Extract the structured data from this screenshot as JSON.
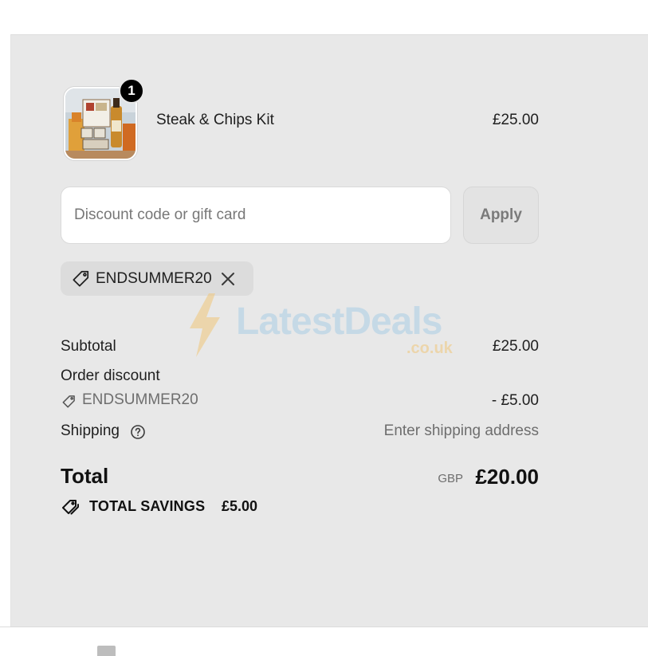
{
  "line_item": {
    "quantity": "1",
    "name": "Steak & Chips Kit",
    "price": "£25.00",
    "image_icon": "product-photo"
  },
  "discount": {
    "placeholder": "Discount code or gift card",
    "value": "",
    "apply_label": "Apply",
    "applied_code": "ENDSUMMER20"
  },
  "watermark": {
    "name": "LatestDeals",
    "suffix": ".co.uk"
  },
  "summary": {
    "subtotal_label": "Subtotal",
    "subtotal_value": "£25.00",
    "order_discount_label": "Order discount",
    "discount_code": "ENDSUMMER20",
    "discount_value": "- £5.00",
    "shipping_label": "Shipping",
    "shipping_value": "Enter shipping address",
    "total_label": "Total",
    "currency": "GBP",
    "total_value": "£20.00",
    "savings_label": "TOTAL SAVINGS",
    "savings_value": "£5.00"
  },
  "colors": {
    "panel_background": "#e8e8e8",
    "badge": "#000000",
    "watermark_blue": "#a9cde6",
    "watermark_gold": "#f0c77a"
  }
}
